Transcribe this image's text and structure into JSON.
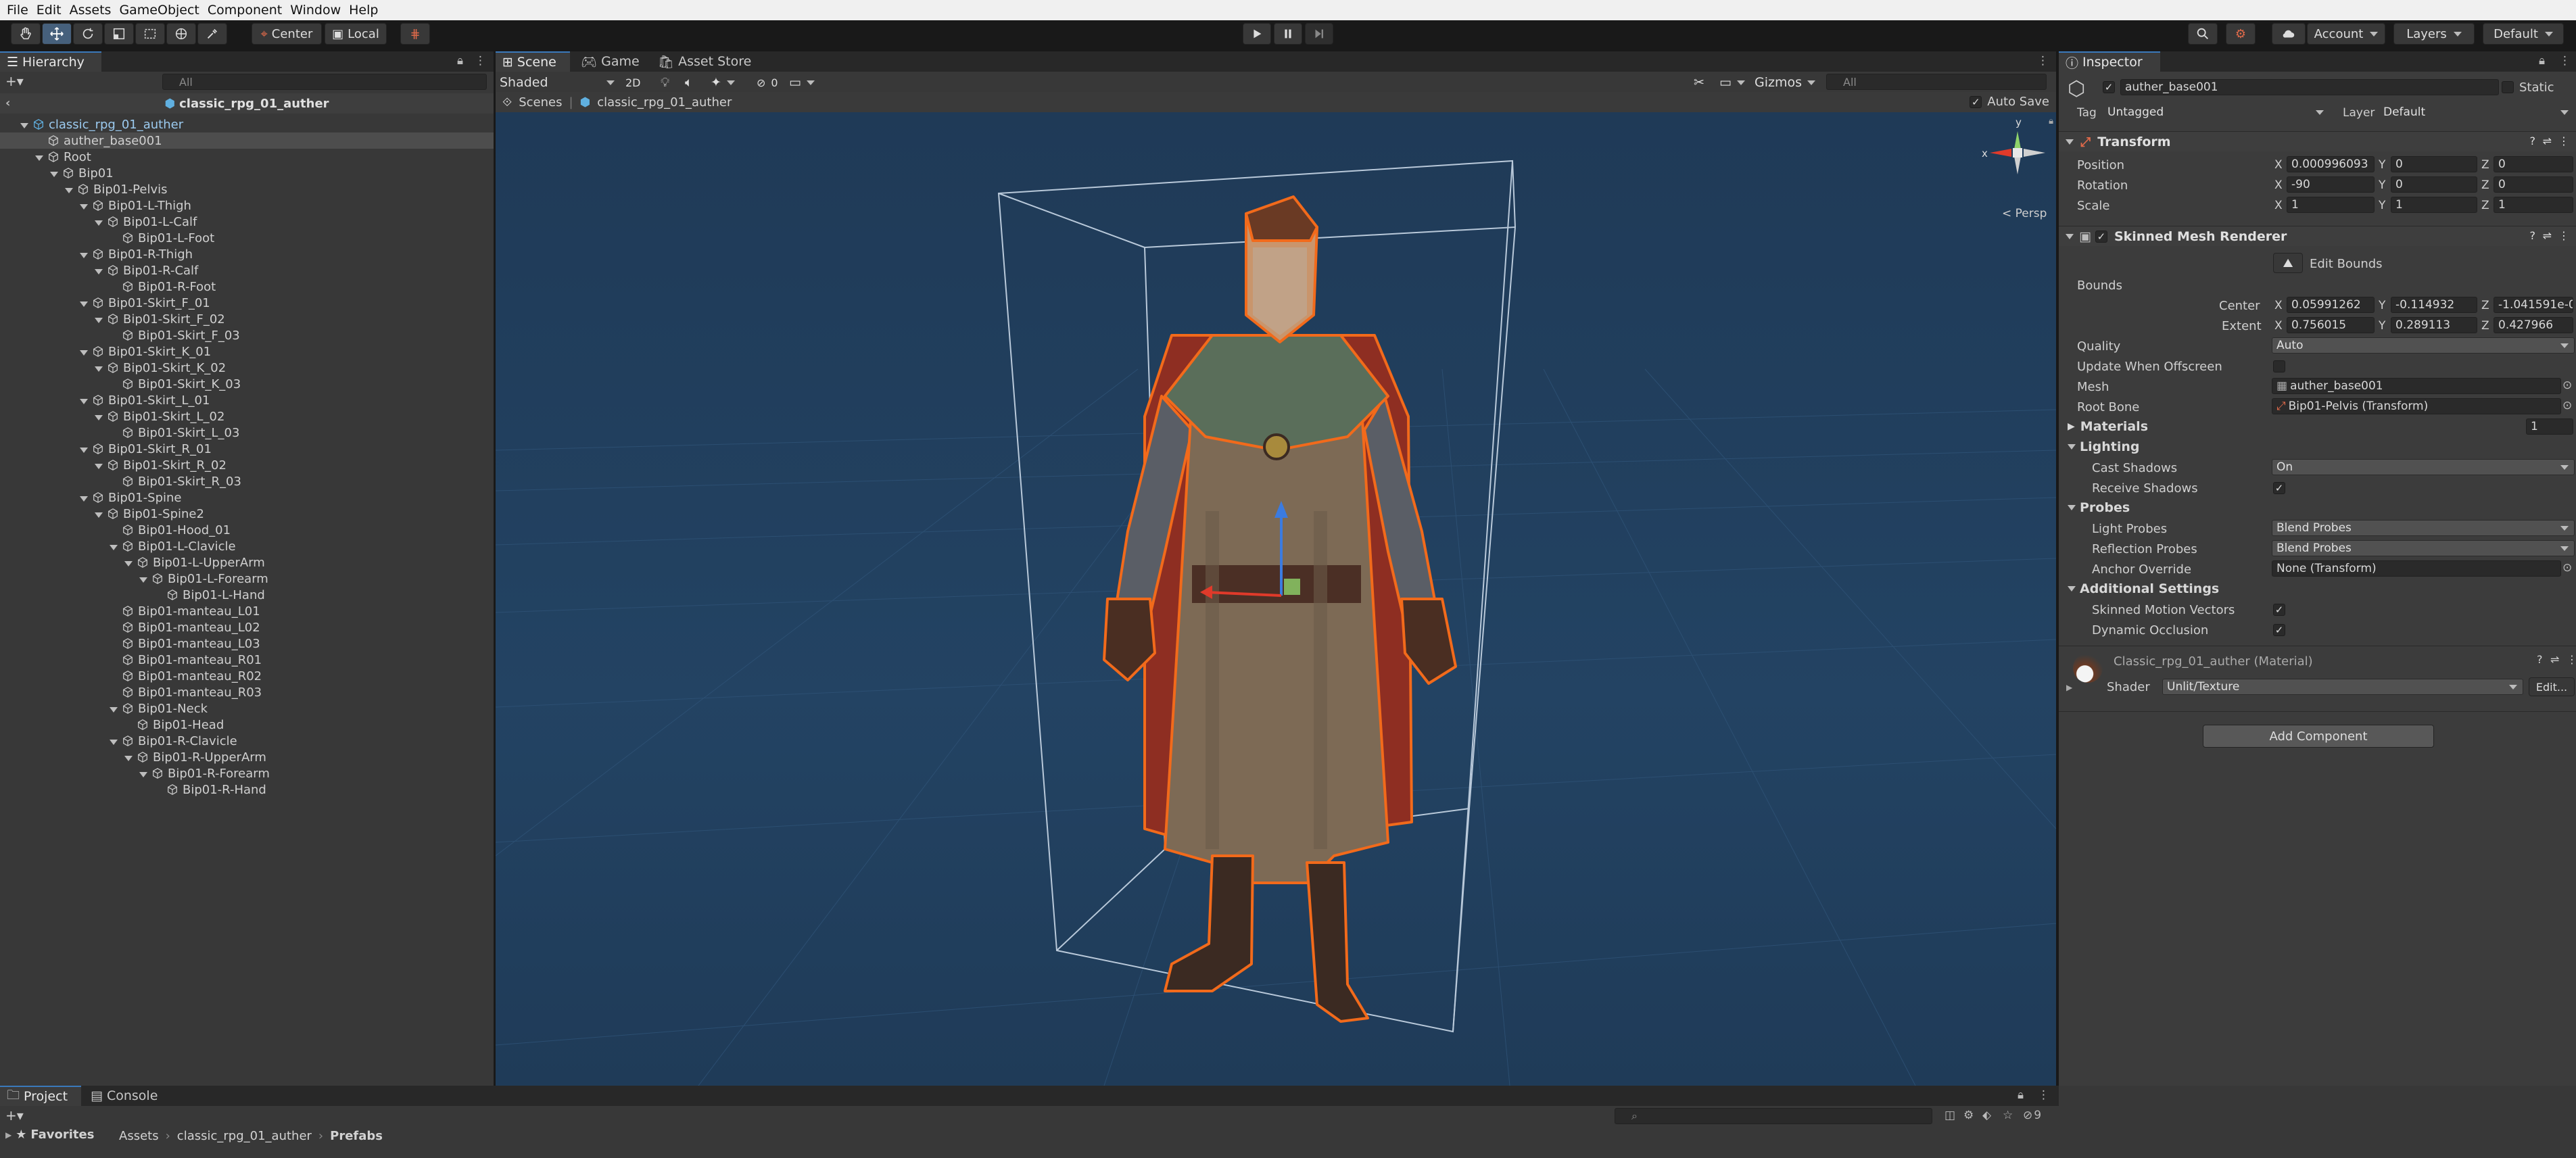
{
  "menu": [
    "File",
    "Edit",
    "Assets",
    "GameObject",
    "Component",
    "Window",
    "Help"
  ],
  "toolbar": {
    "pivot_center": "Center",
    "pivot_local": "Local",
    "account": "Account",
    "layers": "Layers",
    "layout": "Default"
  },
  "hierarchy": {
    "tab": "Hierarchy",
    "search_placeholder": "All",
    "scene_name": "classic_rpg_01_auther",
    "rows": [
      {
        "label": "classic_rpg_01_auther",
        "depth": 0,
        "fold": true,
        "icon": "prefab-icon"
      },
      {
        "label": "auther_base001",
        "depth": 1,
        "fold": false,
        "icon": "cube-icon",
        "selected": true
      },
      {
        "label": "Root",
        "depth": 1,
        "fold": true,
        "icon": "cube-icon"
      },
      {
        "label": "Bip01",
        "depth": 2,
        "fold": true,
        "icon": "cube-icon"
      },
      {
        "label": "Bip01-Pelvis",
        "depth": 3,
        "fold": true,
        "icon": "cube-icon"
      },
      {
        "label": "Bip01-L-Thigh",
        "depth": 4,
        "fold": true,
        "icon": "cube-icon"
      },
      {
        "label": "Bip01-L-Calf",
        "depth": 5,
        "fold": true,
        "icon": "cube-icon"
      },
      {
        "label": "Bip01-L-Foot",
        "depth": 6,
        "fold": false,
        "icon": "cube-icon"
      },
      {
        "label": "Bip01-R-Thigh",
        "depth": 4,
        "fold": true,
        "icon": "cube-icon"
      },
      {
        "label": "Bip01-R-Calf",
        "depth": 5,
        "fold": true,
        "icon": "cube-icon"
      },
      {
        "label": "Bip01-R-Foot",
        "depth": 6,
        "fold": false,
        "icon": "cube-icon"
      },
      {
        "label": "Bip01-Skirt_F_01",
        "depth": 4,
        "fold": true,
        "icon": "cube-icon"
      },
      {
        "label": "Bip01-Skirt_F_02",
        "depth": 5,
        "fold": true,
        "icon": "cube-icon"
      },
      {
        "label": "Bip01-Skirt_F_03",
        "depth": 6,
        "fold": false,
        "icon": "cube-icon"
      },
      {
        "label": "Bip01-Skirt_K_01",
        "depth": 4,
        "fold": true,
        "icon": "cube-icon"
      },
      {
        "label": "Bip01-Skirt_K_02",
        "depth": 5,
        "fold": true,
        "icon": "cube-icon"
      },
      {
        "label": "Bip01-Skirt_K_03",
        "depth": 6,
        "fold": false,
        "icon": "cube-icon"
      },
      {
        "label": "Bip01-Skirt_L_01",
        "depth": 4,
        "fold": true,
        "icon": "cube-icon"
      },
      {
        "label": "Bip01-Skirt_L_02",
        "depth": 5,
        "fold": true,
        "icon": "cube-icon"
      },
      {
        "label": "Bip01-Skirt_L_03",
        "depth": 6,
        "fold": false,
        "icon": "cube-icon"
      },
      {
        "label": "Bip01-Skirt_R_01",
        "depth": 4,
        "fold": true,
        "icon": "cube-icon"
      },
      {
        "label": "Bip01-Skirt_R_02",
        "depth": 5,
        "fold": true,
        "icon": "cube-icon"
      },
      {
        "label": "Bip01-Skirt_R_03",
        "depth": 6,
        "fold": false,
        "icon": "cube-icon"
      },
      {
        "label": "Bip01-Spine",
        "depth": 4,
        "fold": true,
        "icon": "cube-icon"
      },
      {
        "label": "Bip01-Spine2",
        "depth": 5,
        "fold": true,
        "icon": "cube-icon"
      },
      {
        "label": "Bip01-Hood_01",
        "depth": 6,
        "fold": false,
        "icon": "cube-icon"
      },
      {
        "label": "Bip01-L-Clavicle",
        "depth": 6,
        "fold": true,
        "icon": "cube-icon"
      },
      {
        "label": "Bip01-L-UpperArm",
        "depth": 7,
        "fold": true,
        "icon": "cube-icon"
      },
      {
        "label": "Bip01-L-Forearm",
        "depth": 8,
        "fold": true,
        "icon": "cube-icon"
      },
      {
        "label": "Bip01-L-Hand",
        "depth": 9,
        "fold": false,
        "icon": "cube-icon"
      },
      {
        "label": "Bip01-manteau_L01",
        "depth": 6,
        "fold": false,
        "icon": "cube-icon"
      },
      {
        "label": "Bip01-manteau_L02",
        "depth": 6,
        "fold": false,
        "icon": "cube-icon"
      },
      {
        "label": "Bip01-manteau_L03",
        "depth": 6,
        "fold": false,
        "icon": "cube-icon"
      },
      {
        "label": "Bip01-manteau_R01",
        "depth": 6,
        "fold": false,
        "icon": "cube-icon"
      },
      {
        "label": "Bip01-manteau_R02",
        "depth": 6,
        "fold": false,
        "icon": "cube-icon"
      },
      {
        "label": "Bip01-manteau_R03",
        "depth": 6,
        "fold": false,
        "icon": "cube-icon"
      },
      {
        "label": "Bip01-Neck",
        "depth": 6,
        "fold": true,
        "icon": "cube-icon"
      },
      {
        "label": "Bip01-Head",
        "depth": 7,
        "fold": false,
        "icon": "cube-icon"
      },
      {
        "label": "Bip01-R-Clavicle",
        "depth": 6,
        "fold": true,
        "icon": "cube-icon"
      },
      {
        "label": "Bip01-R-UpperArm",
        "depth": 7,
        "fold": true,
        "icon": "cube-icon"
      },
      {
        "label": "Bip01-R-Forearm",
        "depth": 8,
        "fold": true,
        "icon": "cube-icon"
      },
      {
        "label": "Bip01-R-Hand",
        "depth": 9,
        "fold": false,
        "icon": "cube-icon"
      }
    ]
  },
  "scene": {
    "tabs": [
      "Scene",
      "Game",
      "Asset Store"
    ],
    "shading": "Shaded",
    "mode2d": "2D",
    "hidden_count": "0",
    "gizmos": "Gizmos",
    "search_placeholder": "All",
    "breadcrumb_root": "Scenes",
    "breadcrumb_item": "classic_rpg_01_auther",
    "auto_save": "Auto Save",
    "persp": "< Persp",
    "axis_y": "y",
    "axis_x": "x"
  },
  "inspector": {
    "tab": "Inspector",
    "object_name": "auther_base001",
    "static": "Static",
    "tag_label": "Tag",
    "tag_value": "Untagged",
    "layer_label": "Layer",
    "layer_value": "Default",
    "transform": {
      "title": "Transform",
      "rows": [
        {
          "label": "Position",
          "x": "0.000996093",
          "y": "0",
          "z": "0"
        },
        {
          "label": "Rotation",
          "x": "-90",
          "y": "0",
          "z": "0"
        },
        {
          "label": "Scale",
          "x": "1",
          "y": "1",
          "z": "1"
        }
      ]
    },
    "smr": {
      "title": "Skinned Mesh Renderer",
      "edit_bounds": "Edit Bounds",
      "bounds": "Bounds",
      "center_label": "Center",
      "center": {
        "x": "0.05991262",
        "y": "-0.114932",
        "z": "-1.041591e-0"
      },
      "extent_label": "Extent",
      "extent": {
        "x": "0.756015",
        "y": "0.289113",
        "z": "0.427966"
      },
      "quality_label": "Quality",
      "quality": "Auto",
      "update_offscreen": "Update When Offscreen",
      "mesh_label": "Mesh",
      "mesh": "auther_base001",
      "root_bone_label": "Root Bone",
      "root_bone": "Bip01-Pelvis (Transform)",
      "materials": "Materials",
      "materials_count": "1",
      "lighting": "Lighting",
      "cast_shadows_label": "Cast Shadows",
      "cast_shadows": "On",
      "receive_shadows": "Receive Shadows",
      "probes": "Probes",
      "light_probes_label": "Light Probes",
      "light_probes": "Blend Probes",
      "reflection_probes_label": "Reflection Probes",
      "reflection_probes": "Blend Probes",
      "anchor_label": "Anchor Override",
      "anchor": "None (Transform)",
      "additional": "Additional Settings",
      "motion_vectors": "Skinned Motion Vectors",
      "dynamic_occlusion": "Dynamic Occlusion"
    },
    "material": {
      "name": "Classic_rpg_01_auther (Material)",
      "shader_label": "Shader",
      "shader": "Unlit/Texture",
      "edit": "Edit..."
    },
    "add_component": "Add Component"
  },
  "bottom": {
    "tabs": [
      "Project",
      "Console"
    ],
    "favorites": "Favorites",
    "breadcrumb": [
      "Assets",
      "classic_rpg_01_auther",
      "Prefabs"
    ],
    "hidden_count": "9"
  },
  "colors": {
    "accent": "#3a79bb",
    "scene_bg": "#213c5a",
    "selection": "#f26a1b"
  }
}
